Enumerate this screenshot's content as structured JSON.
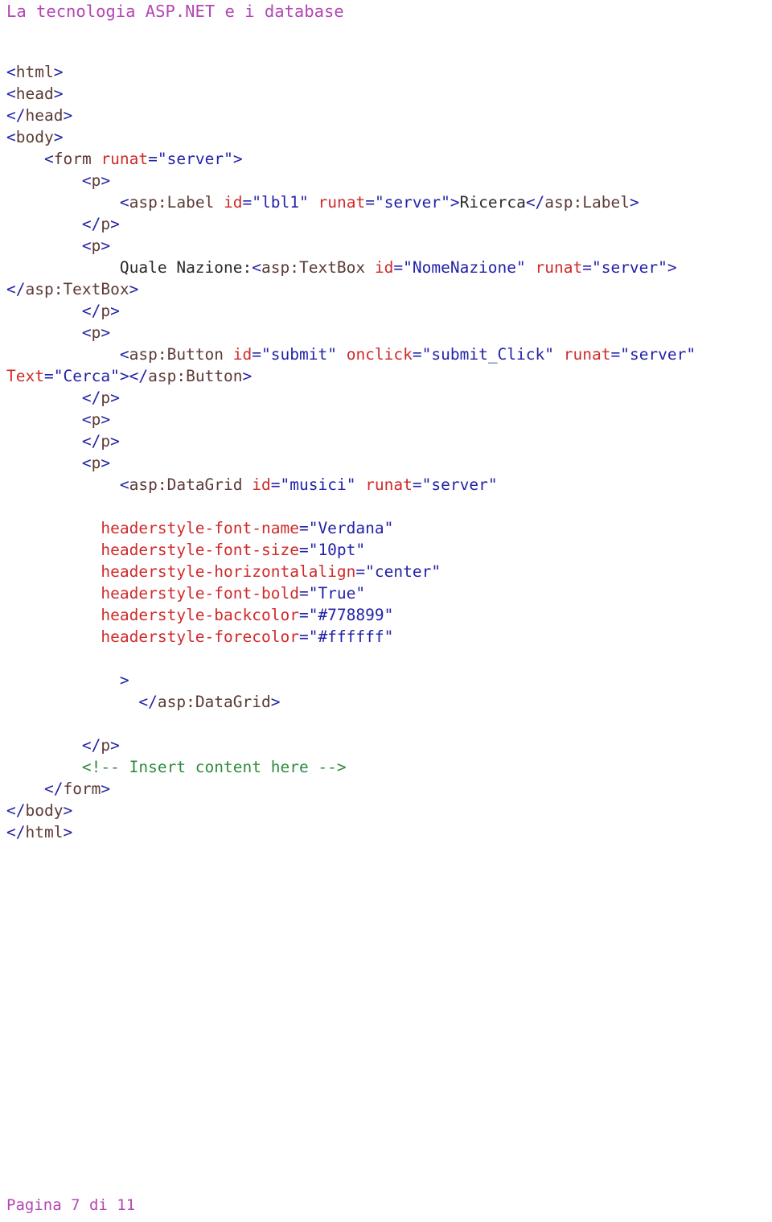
{
  "document": {
    "title": "La tecnologia ASP.NET e i database",
    "footer": "Pagina 7 di 11",
    "title_color": "#b347b3",
    "footer_color": "#b347b3",
    "background_color": "#ffffff"
  },
  "syntax_colors": {
    "punctuation": "#2323a8",
    "tag_name": "#5c3a36",
    "attribute_name": "#d02a2a",
    "attribute_value": "#2323a8",
    "text_node": "#2b2b2b",
    "comment": "#2e8b3d"
  },
  "code_listing": {
    "language": "aspx",
    "lines": [
      {
        "id": "l01",
        "indent": "",
        "tokens": [
          {
            "t": "punct",
            "v": "<"
          },
          {
            "t": "tag",
            "v": "html"
          },
          {
            "t": "punct",
            "v": ">"
          }
        ]
      },
      {
        "id": "l02",
        "indent": "",
        "tokens": [
          {
            "t": "punct",
            "v": "<"
          },
          {
            "t": "tag",
            "v": "head"
          },
          {
            "t": "punct",
            "v": ">"
          }
        ]
      },
      {
        "id": "l03",
        "indent": "",
        "tokens": [
          {
            "t": "punct",
            "v": "</"
          },
          {
            "t": "tag",
            "v": "head"
          },
          {
            "t": "punct",
            "v": ">"
          }
        ]
      },
      {
        "id": "l04",
        "indent": "",
        "tokens": [
          {
            "t": "punct",
            "v": "<"
          },
          {
            "t": "tag",
            "v": "body"
          },
          {
            "t": "punct",
            "v": ">"
          }
        ]
      },
      {
        "id": "l05",
        "indent": "    ",
        "tokens": [
          {
            "t": "punct",
            "v": "<"
          },
          {
            "t": "tag",
            "v": "form"
          },
          {
            "t": "text",
            "v": " "
          },
          {
            "t": "attr",
            "v": "runat"
          },
          {
            "t": "punct",
            "v": "="
          },
          {
            "t": "val",
            "v": "\"server\""
          },
          {
            "t": "punct",
            "v": ">"
          }
        ]
      },
      {
        "id": "l06",
        "indent": "        ",
        "tokens": [
          {
            "t": "punct",
            "v": "<"
          },
          {
            "t": "tag",
            "v": "p"
          },
          {
            "t": "punct",
            "v": ">"
          }
        ]
      },
      {
        "id": "l07",
        "indent": "            ",
        "tokens": [
          {
            "t": "punct",
            "v": "<"
          },
          {
            "t": "tag",
            "v": "asp:Label"
          },
          {
            "t": "text",
            "v": " "
          },
          {
            "t": "attr",
            "v": "id"
          },
          {
            "t": "punct",
            "v": "="
          },
          {
            "t": "val",
            "v": "\"lbl1\""
          },
          {
            "t": "text",
            "v": " "
          },
          {
            "t": "attr",
            "v": "runat"
          },
          {
            "t": "punct",
            "v": "="
          },
          {
            "t": "val",
            "v": "\"server\""
          },
          {
            "t": "punct",
            "v": ">"
          },
          {
            "t": "text",
            "v": "Ricerca"
          },
          {
            "t": "punct",
            "v": "</"
          },
          {
            "t": "tag",
            "v": "asp:Label"
          },
          {
            "t": "punct",
            "v": ">"
          }
        ]
      },
      {
        "id": "l08",
        "indent": "        ",
        "tokens": [
          {
            "t": "punct",
            "v": "</"
          },
          {
            "t": "tag",
            "v": "p"
          },
          {
            "t": "punct",
            "v": ">"
          }
        ]
      },
      {
        "id": "l09",
        "indent": "        ",
        "tokens": [
          {
            "t": "punct",
            "v": "<"
          },
          {
            "t": "tag",
            "v": "p"
          },
          {
            "t": "punct",
            "v": ">"
          }
        ]
      },
      {
        "id": "l10",
        "indent": "            ",
        "tokens": [
          {
            "t": "text",
            "v": "Quale Nazione:"
          },
          {
            "t": "punct",
            "v": "<"
          },
          {
            "t": "tag",
            "v": "asp:TextBox"
          },
          {
            "t": "text",
            "v": " "
          },
          {
            "t": "attr",
            "v": "id"
          },
          {
            "t": "punct",
            "v": "="
          },
          {
            "t": "val",
            "v": "\"NomeNazione\""
          },
          {
            "t": "text",
            "v": " "
          },
          {
            "t": "attr",
            "v": "runat"
          },
          {
            "t": "punct",
            "v": "="
          },
          {
            "t": "val",
            "v": "\"server\""
          },
          {
            "t": "punct",
            "v": "></"
          },
          {
            "t": "tag",
            "v": "asp:TextBox"
          },
          {
            "t": "punct",
            "v": ">"
          }
        ]
      },
      {
        "id": "l11",
        "indent": "        ",
        "tokens": [
          {
            "t": "punct",
            "v": "</"
          },
          {
            "t": "tag",
            "v": "p"
          },
          {
            "t": "punct",
            "v": ">"
          }
        ]
      },
      {
        "id": "l12",
        "indent": "        ",
        "tokens": [
          {
            "t": "punct",
            "v": "<"
          },
          {
            "t": "tag",
            "v": "p"
          },
          {
            "t": "punct",
            "v": ">"
          }
        ]
      },
      {
        "id": "l13",
        "indent": "            ",
        "tokens": [
          {
            "t": "punct",
            "v": "<"
          },
          {
            "t": "tag",
            "v": "asp:Button"
          },
          {
            "t": "text",
            "v": " "
          },
          {
            "t": "attr",
            "v": "id"
          },
          {
            "t": "punct",
            "v": "="
          },
          {
            "t": "val",
            "v": "\"submit\""
          },
          {
            "t": "text",
            "v": " "
          },
          {
            "t": "attr",
            "v": "onclick"
          },
          {
            "t": "punct",
            "v": "="
          },
          {
            "t": "val",
            "v": "\"submit_Click\""
          },
          {
            "t": "text",
            "v": " "
          },
          {
            "t": "attr",
            "v": "runat"
          },
          {
            "t": "punct",
            "v": "="
          },
          {
            "t": "val",
            "v": "\"server\""
          },
          {
            "t": "text",
            "v": " "
          },
          {
            "t": "attr",
            "v": "Text"
          },
          {
            "t": "punct",
            "v": "="
          },
          {
            "t": "val",
            "v": "\"Cerca\""
          },
          {
            "t": "punct",
            "v": "></"
          },
          {
            "t": "tag",
            "v": "asp:Button"
          },
          {
            "t": "punct",
            "v": ">"
          }
        ]
      },
      {
        "id": "l14",
        "indent": "        ",
        "tokens": [
          {
            "t": "punct",
            "v": "</"
          },
          {
            "t": "tag",
            "v": "p"
          },
          {
            "t": "punct",
            "v": ">"
          }
        ]
      },
      {
        "id": "l15",
        "indent": "        ",
        "tokens": [
          {
            "t": "punct",
            "v": "<"
          },
          {
            "t": "tag",
            "v": "p"
          },
          {
            "t": "punct",
            "v": ">"
          }
        ]
      },
      {
        "id": "l16",
        "indent": "        ",
        "tokens": [
          {
            "t": "punct",
            "v": "</"
          },
          {
            "t": "tag",
            "v": "p"
          },
          {
            "t": "punct",
            "v": ">"
          }
        ]
      },
      {
        "id": "l17",
        "indent": "        ",
        "tokens": [
          {
            "t": "punct",
            "v": "<"
          },
          {
            "t": "tag",
            "v": "p"
          },
          {
            "t": "punct",
            "v": ">"
          }
        ]
      },
      {
        "id": "l18",
        "indent": "            ",
        "tokens": [
          {
            "t": "punct",
            "v": "<"
          },
          {
            "t": "tag",
            "v": "asp:DataGrid"
          },
          {
            "t": "text",
            "v": " "
          },
          {
            "t": "attr",
            "v": "id"
          },
          {
            "t": "punct",
            "v": "="
          },
          {
            "t": "val",
            "v": "\"musici\""
          },
          {
            "t": "text",
            "v": " "
          },
          {
            "t": "attr",
            "v": "runat"
          },
          {
            "t": "punct",
            "v": "="
          },
          {
            "t": "val",
            "v": "\"server\""
          }
        ]
      },
      {
        "id": "l19",
        "indent": "",
        "tokens": []
      },
      {
        "id": "l20",
        "indent": "          ",
        "tokens": [
          {
            "t": "attr",
            "v": "headerstyle-font-name"
          },
          {
            "t": "punct",
            "v": "="
          },
          {
            "t": "val",
            "v": "\"Verdana\""
          }
        ]
      },
      {
        "id": "l21",
        "indent": "          ",
        "tokens": [
          {
            "t": "attr",
            "v": "headerstyle-font-size"
          },
          {
            "t": "punct",
            "v": "="
          },
          {
            "t": "val",
            "v": "\"10pt\""
          }
        ]
      },
      {
        "id": "l22",
        "indent": "          ",
        "tokens": [
          {
            "t": "attr",
            "v": "headerstyle-horizontalalign"
          },
          {
            "t": "punct",
            "v": "="
          },
          {
            "t": "val",
            "v": "\"center\""
          }
        ]
      },
      {
        "id": "l23",
        "indent": "          ",
        "tokens": [
          {
            "t": "attr",
            "v": "headerstyle-font-bold"
          },
          {
            "t": "punct",
            "v": "="
          },
          {
            "t": "val",
            "v": "\"True\""
          }
        ]
      },
      {
        "id": "l24",
        "indent": "          ",
        "tokens": [
          {
            "t": "attr",
            "v": "headerstyle-backcolor"
          },
          {
            "t": "punct",
            "v": "="
          },
          {
            "t": "val",
            "v": "\"#778899\""
          }
        ]
      },
      {
        "id": "l25",
        "indent": "          ",
        "tokens": [
          {
            "t": "attr",
            "v": "headerstyle-forecolor"
          },
          {
            "t": "punct",
            "v": "="
          },
          {
            "t": "val",
            "v": "\"#ffffff\""
          }
        ]
      },
      {
        "id": "l26",
        "indent": "",
        "tokens": []
      },
      {
        "id": "l27",
        "indent": "            ",
        "tokens": [
          {
            "t": "punct",
            "v": ">"
          }
        ]
      },
      {
        "id": "l28",
        "indent": "              ",
        "tokens": [
          {
            "t": "punct",
            "v": "</"
          },
          {
            "t": "tag",
            "v": "asp:DataGrid"
          },
          {
            "t": "punct",
            "v": ">"
          }
        ]
      },
      {
        "id": "l29",
        "indent": "",
        "tokens": []
      },
      {
        "id": "l30",
        "indent": "        ",
        "tokens": [
          {
            "t": "punct",
            "v": "</"
          },
          {
            "t": "tag",
            "v": "p"
          },
          {
            "t": "punct",
            "v": ">"
          }
        ]
      },
      {
        "id": "l31",
        "indent": "        ",
        "tokens": [
          {
            "t": "comment",
            "v": "<!-- Insert content here -->"
          }
        ]
      },
      {
        "id": "l32",
        "indent": "    ",
        "tokens": [
          {
            "t": "punct",
            "v": "</"
          },
          {
            "t": "tag",
            "v": "form"
          },
          {
            "t": "punct",
            "v": ">"
          }
        ]
      },
      {
        "id": "l33",
        "indent": "",
        "tokens": [
          {
            "t": "punct",
            "v": "</"
          },
          {
            "t": "tag",
            "v": "body"
          },
          {
            "t": "punct",
            "v": ">"
          }
        ]
      },
      {
        "id": "l34",
        "indent": "",
        "tokens": [
          {
            "t": "punct",
            "v": "</"
          },
          {
            "t": "tag",
            "v": "html"
          },
          {
            "t": "punct",
            "v": ">"
          }
        ]
      }
    ]
  }
}
